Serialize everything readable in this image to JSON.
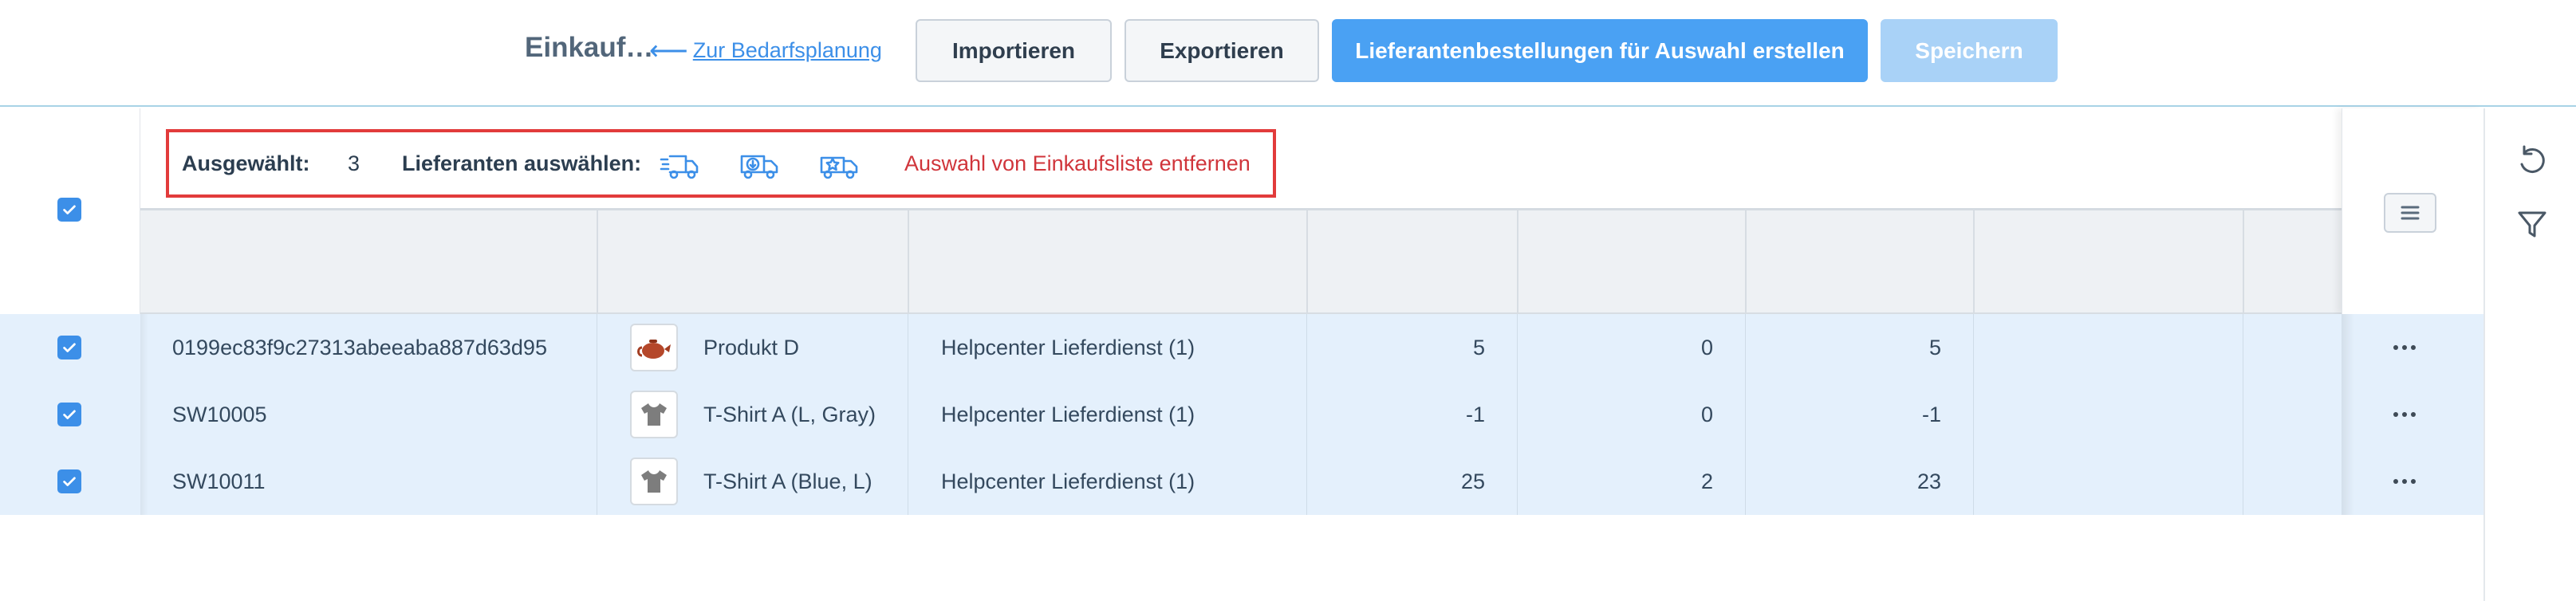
{
  "header": {
    "title": "Einkauf…",
    "back_link": "Zur Bedarfsplanung",
    "import_label": "Importieren",
    "export_label": "Exportieren",
    "create_orders_label": "Lieferantenbestellungen für Auswahl erstellen",
    "save_label": "Speichern"
  },
  "selection_bar": {
    "selected_label": "Ausgewählt:",
    "selected_count": "3",
    "choose_suppliers_label": "Lieferanten auswählen:",
    "supplier_icons": [
      "fast-delivery-truck-icon",
      "truck-download-icon",
      "truck-star-icon"
    ],
    "remove_label": "Auswahl von Einkaufsliste entfernen"
  },
  "rows": [
    {
      "sku": "0199ec83f9c27313abeeaba887d63d95",
      "product": "Produkt D",
      "thumb_icon": "teapot-icon",
      "supplier": "Helpcenter Lieferdienst (1)",
      "col1": "5",
      "col2": "0",
      "col3": "5"
    },
    {
      "sku": "SW10005",
      "product": "T-Shirt A (L, Gray)",
      "thumb_icon": "tshirt-icon",
      "supplier": "Helpcenter Lieferdienst (1)",
      "col1": "-1",
      "col2": "0",
      "col3": "-1"
    },
    {
      "sku": "SW10011",
      "product": "T-Shirt A (Blue, L)",
      "thumb_icon": "tshirt-icon",
      "supplier": "Helpcenter Lieferdienst (1)",
      "col1": "25",
      "col2": "2",
      "col3": "23"
    }
  ],
  "colors": {
    "accent": "#3c8fe8",
    "primary_button": "#4aa1f3",
    "disabled_button": "#a9d2f7",
    "danger": "#d0353b",
    "selected_row": "#e4f0fc",
    "highlight_frame": "#e23b3b"
  },
  "right_sidebar": {
    "icons": [
      "reset-icon",
      "filter-icon"
    ]
  }
}
